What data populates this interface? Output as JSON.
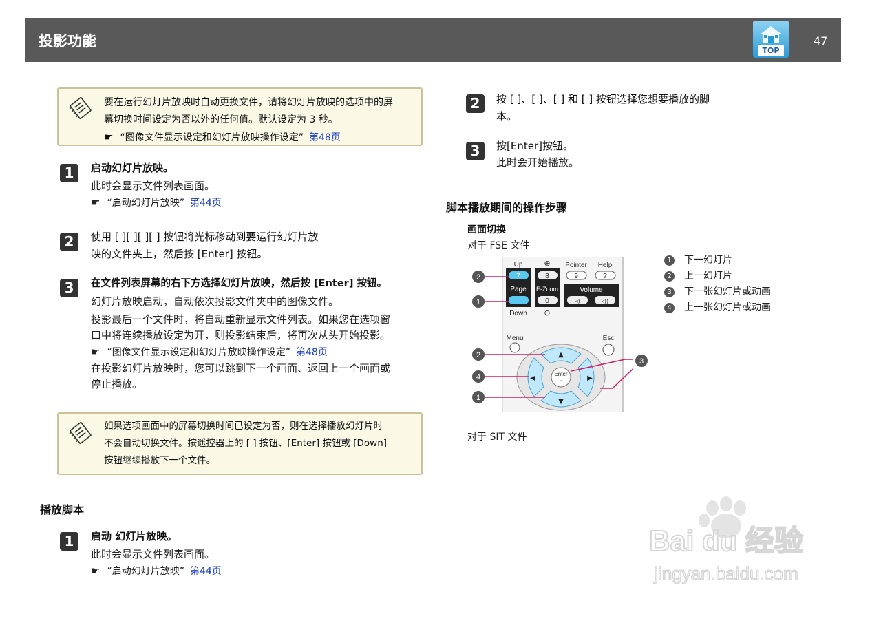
{
  "header": {
    "title": "投影功能",
    "top_label": "TOP",
    "page_number": "47"
  },
  "note1": {
    "line1": "要在运行幻灯片放映时自动更换文件，请将幻灯片放映的选项中的屏",
    "line2": "幕切换时间设定为否以外的任何值。默认设定为 3 秒。",
    "ref_text": "“图像文件显示设定和幻灯片放映操作设定”",
    "ref_page": "第48页"
  },
  "left_steps": [
    {
      "num": "1",
      "title": "启动幻灯片放映。",
      "body": "此时会显示文件列表画面。",
      "ref_text": "“启动幻灯片放映”",
      "ref_page": "第44页"
    },
    {
      "num": "2",
      "line1": "使用 [     ][     ][ ][ ] 按钮将光标移动到要运行幻灯片放",
      "line2": "映的文件夹上，然后按 [Enter] 按钮。"
    },
    {
      "num": "3",
      "title": "在文件列表屏幕的右下方选择幻灯片放映，然后按 [Enter] 按钮。",
      "body1": "幻灯片放映启动，自动依次投影文件夹中的图像文件。",
      "body2a": "投影最后一个文件时，将自动重新显示文件列表。如果您在选项窗",
      "body2b": "口中将连续播放设定为开，则投影结束后，将再次从头开始投影。",
      "ref_text": "“图像文件显示设定和幻灯片放映操作设定”",
      "ref_page": "第48页",
      "body3a": "在投影幻灯片放映时，您可以跳到下一个画面、返回上一个画面或",
      "body3b": "停止播放。"
    }
  ],
  "note2": {
    "line1": "如果选项画面中的屏幕切换时间已设定为否，则在选择播放幻灯片时",
    "line2": "不会自动切换文件。按遥控器上的 [ ] 按钮、[Enter] 按钮或 [Down]",
    "line3": "按钮继续播放下一个文件。"
  },
  "script_section": {
    "heading": "播放脚本",
    "step": {
      "num": "1",
      "title": "启动  幻灯片放映。",
      "body": "此时会显示文件列表画面。",
      "ref_text": "“启动幻灯片放映”",
      "ref_page": "第44页"
    }
  },
  "right_steps": [
    {
      "num": "2",
      "line1": "按 [     ]、[     ]、[ ] 和 [ ] 按钮选择您想要播放的脚",
      "line2": "本。"
    },
    {
      "num": "3",
      "title": "按[Enter]按钮。",
      "body": "此时会开始播放。"
    }
  ],
  "ops": {
    "heading": "脚本播放期间的操作步骤",
    "subheading": "画面切换",
    "fse": "对于 FSE 文件",
    "sit": "对于 SIT 文件",
    "legend": [
      {
        "num": "1",
        "text": "下一幻灯片"
      },
      {
        "num": "2",
        "text": "上一幻灯片"
      },
      {
        "num": "3",
        "text": "下一张幻灯片或动画"
      },
      {
        "num": "4",
        "text": "上一张幻灯片或动画"
      }
    ]
  },
  "remote": {
    "up": "Up",
    "page": "Page",
    "down": "Down",
    "key7": "7",
    "key8": "8",
    "key9": "9",
    "key0": "0",
    "help_key": "?",
    "ezoom": "E-Zoom",
    "pointer": "Pointer",
    "help": "Help",
    "volume": "Volume",
    "menu": "Menu",
    "esc": "Esc",
    "enter": "Enter",
    "callouts": [
      "2",
      "1",
      "2",
      "4",
      "1",
      "3"
    ]
  },
  "watermark": {
    "brand": "Bai du 经验",
    "url": "jingyan.baidu.com"
  },
  "colors": {
    "header_bg": "#595959",
    "note_bg": "#fbf8e6",
    "link": "#1a3fbf",
    "key_highlight": "#5bc8f0",
    "callout_line": "#d01c6a"
  }
}
